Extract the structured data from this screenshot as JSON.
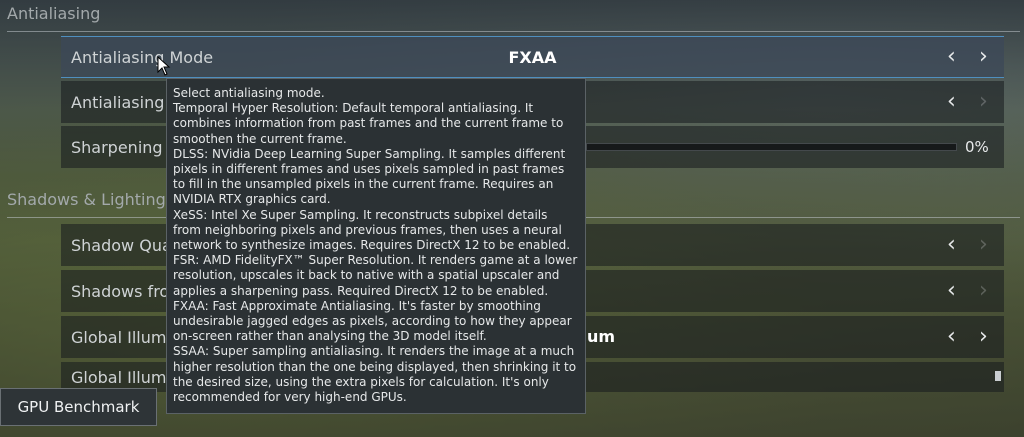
{
  "sections": {
    "antialiasing": "Antialiasing",
    "shadows_lighting": "Shadows & Lighting"
  },
  "rows": {
    "aa_mode": {
      "label": "Antialiasing Mode",
      "value": "FXAA"
    },
    "aa_quality": {
      "label": "Antialiasing"
    },
    "sharpening": {
      "label": "Sharpening",
      "value": "0%"
    },
    "shadow_quality": {
      "label": "Shadow Qua"
    },
    "shadows_from": {
      "label": "Shadows fro"
    },
    "gi": {
      "label": "Global Illum",
      "value": "um"
    },
    "gi2": {
      "label": "Global Illum"
    }
  },
  "tooltip": {
    "text": "Select antialiasing mode.\nTemporal Hyper Resolution: Default temporal antialiasing. It combines information from past frames and the current frame to smoothen the current frame.\nDLSS: NVidia Deep Learning Super Sampling. It samples different pixels in different frames and uses pixels sampled in past frames to fill in the unsampled pixels in the current frame. Requires an NVIDIA RTX graphics card.\nXeSS: Intel Xe Super Sampling. It reconstructs subpixel details from neighboring pixels and previous frames, then uses a neural network to synthesize images. Requires DirectX 12 to be enabled.\nFSR: AMD FidelityFX™ Super Resolution. It renders game at a lower resolution, upscales it back to native with a spatial upscaler and applies a sharpening pass. Required DirectX 12 to be enabled.\nFXAA: Fast Approximate Antialiasing. It's faster by smoothing undesirable jagged edges as pixels, according to how they appear on-screen rather than analysing the 3D model itself.\nSSAA: Super sampling antialiasing. It renders the image at a much higher resolution than the one being displayed, then shrinking it to the desired size, using the extra pixels for calculation. It's only recommended for very high-end GPUs."
  },
  "buttons": {
    "gpu_benchmark": "GPU Benchmark"
  },
  "icons": {
    "prev": "‹",
    "next": "›"
  },
  "colors": {
    "selection_border": "#4f8fbf",
    "tooltip_bg": "#2b3134"
  }
}
